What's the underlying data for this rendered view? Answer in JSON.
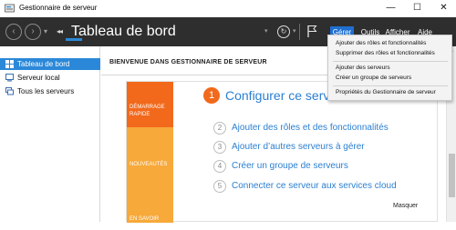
{
  "window": {
    "title": "Gestionnaire de serveur",
    "minimize_glyph": "—",
    "maximize_glyph": "☐",
    "close_glyph": "✕"
  },
  "navbar": {
    "back_glyph": "‹",
    "forward_glyph": "›",
    "dropdown_glyph": "▾",
    "breadcrumb_glyph": "◂◂",
    "page_title": "Tableau de bord",
    "refresh_glyph": "↻",
    "menus": [
      {
        "label": "Gérer",
        "active": true
      },
      {
        "label": "Outils",
        "active": false
      },
      {
        "label": "Afficher",
        "active": false
      },
      {
        "label": "Aide",
        "active": false
      }
    ]
  },
  "sidebar": {
    "items": [
      {
        "label": "Tableau de bord",
        "icon": "dashboard-icon",
        "selected": true
      },
      {
        "label": "Serveur local",
        "icon": "server-icon",
        "selected": false
      },
      {
        "label": "Tous les serveurs",
        "icon": "servers-icon",
        "selected": false
      }
    ]
  },
  "main": {
    "welcome": "BIENVENUE DANS GESTIONNAIRE DE SERVEUR",
    "tiles": [
      {
        "label_line1": "DÉMARRAGE",
        "label_line2": "RAPIDE"
      },
      {
        "label_line1": "NOUVEAUTÉS"
      },
      {
        "label_line1": "EN SAVOIR PLUS"
      }
    ],
    "main_step": {
      "num": "1",
      "label": "Configurer ce serveur local"
    },
    "steps": [
      {
        "num": "2",
        "label": "Ajouter des rôles et des fonctionnalités"
      },
      {
        "num": "3",
        "label": "Ajouter d’autres serveurs à gérer"
      },
      {
        "num": "4",
        "label": "Créer un groupe de serveurs"
      },
      {
        "num": "5",
        "label": "Connecter ce serveur aux services cloud"
      }
    ],
    "hide_label": "Masquer"
  },
  "dropdown": {
    "items": [
      "Ajouter des rôles et fonctionnalités",
      "Supprimer des rôles et fonctionnalités",
      "Ajouter des serveurs",
      "Créer un groupe de serveurs",
      "Propriétés du Gestionnaire de serveur"
    ]
  },
  "colors": {
    "accent": "#2b88d8",
    "menu_active": "#1f6fd1",
    "tile_orange": "#f2691c",
    "tile_light_orange": "#f7a93a",
    "link_blue": "#2b7fd0",
    "navbar_bg": "#2e2e2e"
  }
}
